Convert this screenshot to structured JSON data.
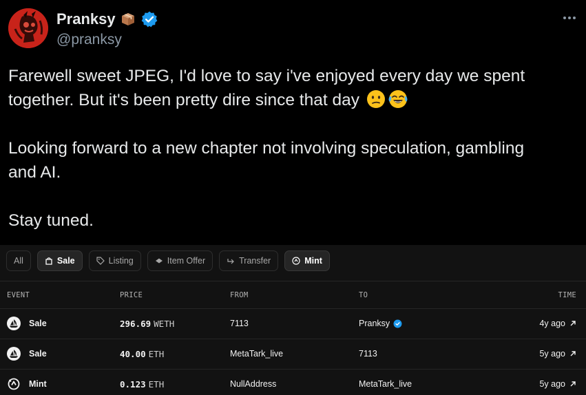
{
  "tweet": {
    "display_name": "Pranksy",
    "handle": "@pranksy",
    "line1": "Farewell sweet JPEG, I'd love to say i've enjoyed every day we spent",
    "line2": "together. But it's been pretty dire since that day",
    "line3": "Looking forward to a new chapter not involving speculation, gambling",
    "line4": "and AI.",
    "line5": "Stay tuned.",
    "icons": [
      "box-emoji-icon",
      "verified-badge-icon",
      "more-options-icon",
      "confused-face-emoji",
      "tears-of-joy-emoji"
    ]
  },
  "filters": [
    {
      "label": "All",
      "active": false
    },
    {
      "label": "Sale",
      "active": true
    },
    {
      "label": "Listing",
      "active": false
    },
    {
      "label": "Item Offer",
      "active": false
    },
    {
      "label": "Transfer",
      "active": false
    },
    {
      "label": "Mint",
      "active": true
    }
  ],
  "table": {
    "headers": {
      "event": "EVENT",
      "price": "PRICE",
      "from": "FROM",
      "to": "TO",
      "time": "TIME"
    },
    "rows": [
      {
        "event": "Sale",
        "price": "296.69",
        "currency": "WETH",
        "from": "7113",
        "to": "Pranksy",
        "to_verified": true,
        "time": "4y ago"
      },
      {
        "event": "Sale",
        "price": "40.00",
        "currency": "ETH",
        "from": "MetaTark_live",
        "to": "7113",
        "to_verified": false,
        "time": "5y ago"
      },
      {
        "event": "Mint",
        "price": "0.123",
        "currency": "ETH",
        "from": "NullAddress",
        "to": "MetaTark_live",
        "to_verified": false,
        "time": "5y ago"
      }
    ]
  },
  "colors": {
    "background": "#000000",
    "panel": "#121212",
    "verified": "#1d9bf0",
    "text": "#e7e9ea",
    "muted": "#8b98a5"
  }
}
